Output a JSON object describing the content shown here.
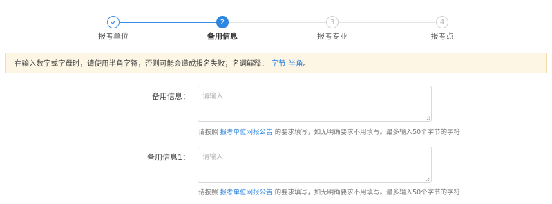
{
  "steps": [
    {
      "label": "报考单位",
      "number": "✓",
      "state": "done"
    },
    {
      "label": "备用信息",
      "number": "2",
      "state": "active"
    },
    {
      "label": "报考专业",
      "number": "3",
      "state": "todo"
    },
    {
      "label": "报考点",
      "number": "4",
      "state": "todo"
    }
  ],
  "notice": {
    "text": "在输入数字或字母时，请使用半角字符，否则可能会造成报名失败；名词解释：",
    "link_byte": "字节",
    "link_halfwidth": "半角",
    "end": "。"
  },
  "fields": [
    {
      "label": "备用信息：",
      "placeholder": "请输入",
      "value": "",
      "hint_prefix": "请按照",
      "hint_link": "报考单位网报公告",
      "hint_suffix": "的要求填写，如无明确要求不用填写。最多输入50个字节的字符"
    },
    {
      "label": "备用信息1：",
      "placeholder": "请输入",
      "value": "",
      "hint_prefix": "请按照",
      "hint_link": "报考单位网报公告",
      "hint_suffix": "的要求填写，如无明确要求不用填写。最多输入50个字节的字符"
    }
  ],
  "colors": {
    "primary": "#2f86e0",
    "notice_bg": "#fdf6e5",
    "notice_border": "#f3dcab",
    "todo": "#cfcfcf"
  }
}
